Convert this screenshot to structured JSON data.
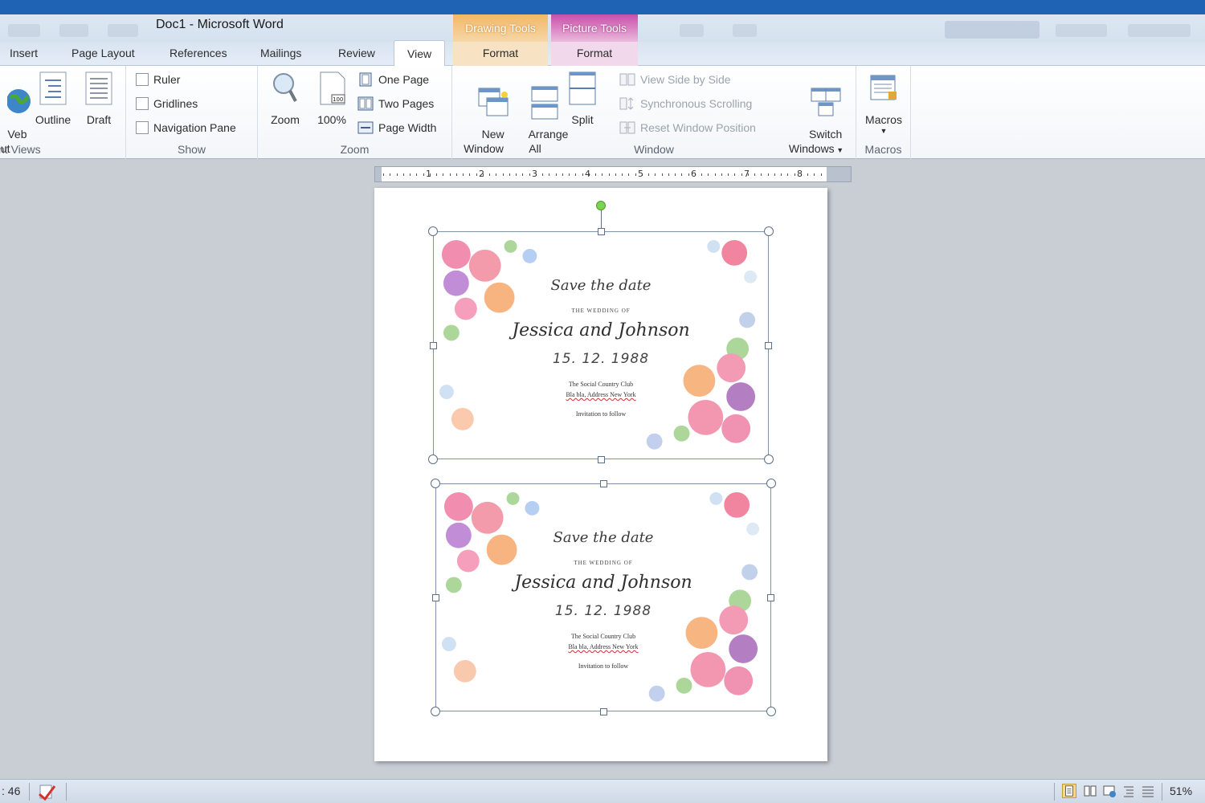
{
  "window": {
    "title": "Doc1  -  Microsoft Word"
  },
  "contextual_tabs": [
    {
      "group": "Drawing Tools",
      "tab": "Format",
      "color": "#f2b766"
    },
    {
      "group": "Picture Tools",
      "tab": "Format",
      "color": "#c84fa8"
    }
  ],
  "tabs": [
    "Insert",
    "Page Layout",
    "References",
    "Mailings",
    "Review",
    "View"
  ],
  "active_tab": "View",
  "ribbon": {
    "views": {
      "label": "nt Views",
      "web_layout": "Veb\nyout",
      "outline": "Outline",
      "draft": "Draft"
    },
    "show": {
      "label": "Show",
      "ruler": "Ruler",
      "gridlines": "Gridlines",
      "navigation_pane": "Navigation Pane"
    },
    "zoom": {
      "label": "Zoom",
      "zoom": "Zoom",
      "hundred": "100%",
      "one_page": "One Page",
      "two_pages": "Two Pages",
      "page_width": "Page Width"
    },
    "window": {
      "label": "Window",
      "new_window": "New\nWindow",
      "arrange_all": "Arrange\nAll",
      "split": "Split",
      "view_side_by_side": "View Side by Side",
      "sync_scrolling": "Synchronous Scrolling",
      "reset_position": "Reset Window Position",
      "switch_windows": "Switch\nWindows"
    },
    "macros": {
      "label": "Macros",
      "macros": "Macros"
    }
  },
  "ruler": {
    "numbers": [
      "1",
      "2",
      "3",
      "4",
      "5",
      "6",
      "7",
      "8"
    ]
  },
  "cards": [
    {
      "save": "Save the date",
      "wedding_of": "THE WEDDING OF",
      "names": "Jessica and Johnson",
      "date": "15. 12. 1988",
      "venue": "The Social Country Club",
      "address": "Bla bla, Address New York",
      "reception": "Invitation to follow"
    },
    {
      "save": "Save the date",
      "wedding_of": "THE WEDDING OF",
      "names": "Jessica and Johnson",
      "date": "15. 12. 1988",
      "venue": "The Social Country Club",
      "address": "Bla bla, Address New York",
      "reception": "Invitation to follow"
    }
  ],
  "statusbar": {
    "page_info": ": 46",
    "zoom": "51%"
  }
}
